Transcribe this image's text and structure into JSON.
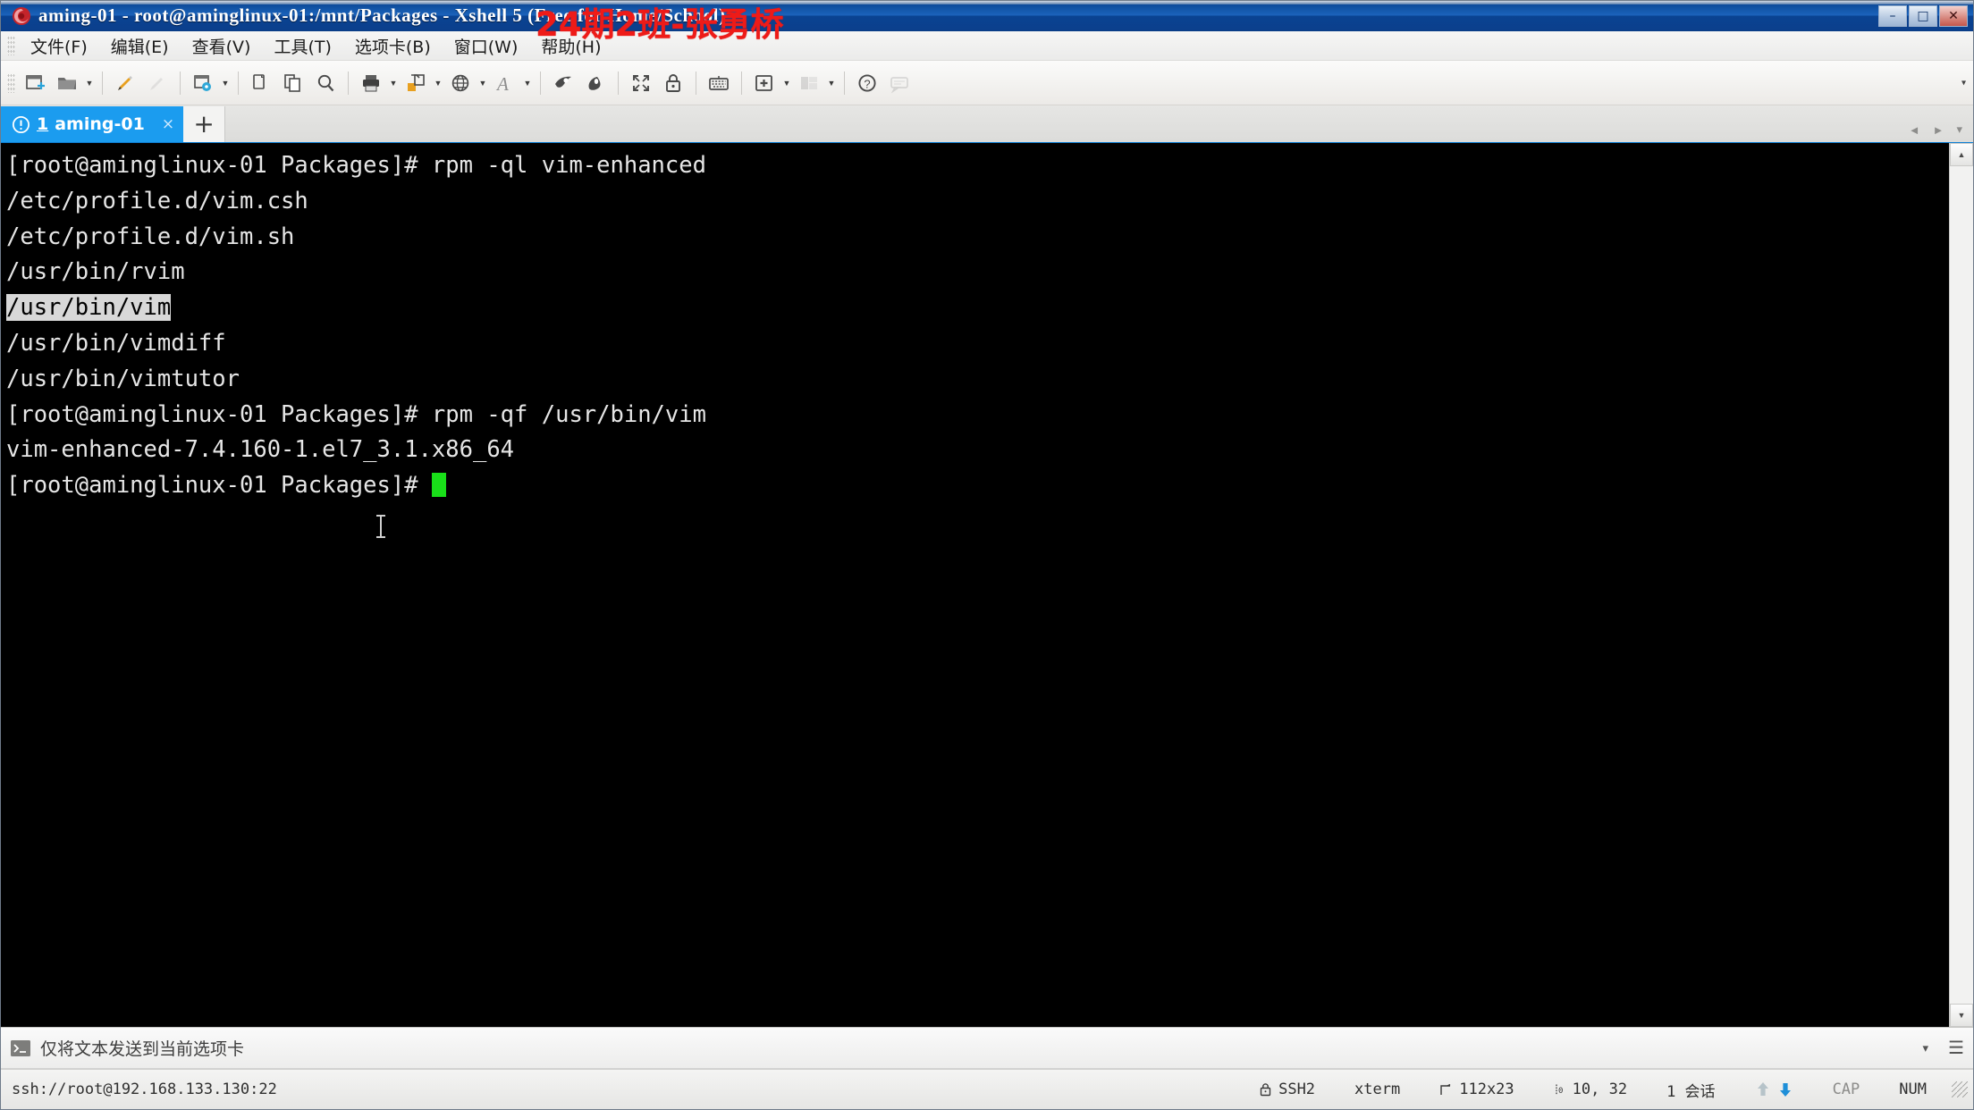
{
  "window": {
    "title": "aming-01 - root@aminglinux-01:/mnt/Packages - Xshell 5 (Free for Home/School)",
    "overlay_text": "24期2班-张勇桥",
    "overlay_color": "#ee1b18",
    "minimize": "–",
    "maximize": "□",
    "close": "✕"
  },
  "menu": {
    "items": [
      {
        "label": "文件(F)",
        "name": "menu-file"
      },
      {
        "label": "编辑(E)",
        "name": "menu-edit"
      },
      {
        "label": "查看(V)",
        "name": "menu-view"
      },
      {
        "label": "工具(T)",
        "name": "menu-tools"
      },
      {
        "label": "选项卡(B)",
        "name": "menu-tabs"
      },
      {
        "label": "窗口(W)",
        "name": "menu-window"
      },
      {
        "label": "帮助(H)",
        "name": "menu-help"
      }
    ]
  },
  "toolbar": {
    "overflow_label": "▾",
    "icons": [
      "new-session-icon",
      "open-folder-icon",
      "connect-icon",
      "disconnect-icon",
      "session-properties-icon",
      "copy-icon",
      "paste-icon",
      "find-icon",
      "print-icon",
      "transfer-icon",
      "globe-icon",
      "font-icon",
      "xftp-icon",
      "xagent-icon",
      "fullscreen-icon",
      "lock-icon",
      "keyboard-icon",
      "new-tab-icon",
      "layout-icon",
      "help-icon",
      "chat-icon"
    ]
  },
  "tabs": {
    "active": {
      "warn_icon": "warning-icon",
      "number": "1",
      "label": "aming-01",
      "close": "×"
    },
    "new_tab_label": "+",
    "scroll_left": "◄",
    "scroll_right": "►",
    "menu": "▾"
  },
  "terminal": {
    "lines": [
      {
        "text": "[root@aminglinux-01 Packages]# rpm -ql vim-enhanced"
      },
      {
        "text": "/etc/profile.d/vim.csh"
      },
      {
        "text": "/etc/profile.d/vim.sh"
      },
      {
        "text": "/usr/bin/rvim"
      },
      {
        "text": "/usr/bin/vim",
        "selected": true
      },
      {
        "text": "/usr/bin/vimdiff"
      },
      {
        "text": "/usr/bin/vimtutor"
      },
      {
        "text": "[root@aminglinux-01 Packages]# rpm -qf /usr/bin/vim"
      },
      {
        "text": "vim-enhanced-7.4.160-1.el7_3.1.x86_64"
      },
      {
        "text": "[root@aminglinux-01 Packages]# ",
        "cursor": true
      }
    ],
    "colors": {
      "bg": "#000000",
      "fg": "#e6e6e6",
      "cursor": "#19e019",
      "selection_bg": "#d8d8d8"
    }
  },
  "scrollbar": {
    "up": "▲",
    "down": "▼"
  },
  "sendbar": {
    "icon": "terminal-prompt-icon",
    "text": "仅将文本发送到当前选项卡",
    "dropdown": "▾",
    "menu_icon": "☰"
  },
  "statusbar": {
    "connection": "ssh://root@192.168.133.130:22",
    "protocol": "SSH2",
    "protocol_icon": "lock-icon",
    "terminal_type": "xterm",
    "size_icon": "screen-size-icon",
    "size": "112x23",
    "cursor_icon": "cursor-position-icon",
    "cursor_position": "10, 32",
    "sessions": "1 会话",
    "upload_icon": "upload-arrow-icon",
    "download_icon": "download-arrow-icon",
    "caps": "CAP",
    "num": "NUM"
  }
}
